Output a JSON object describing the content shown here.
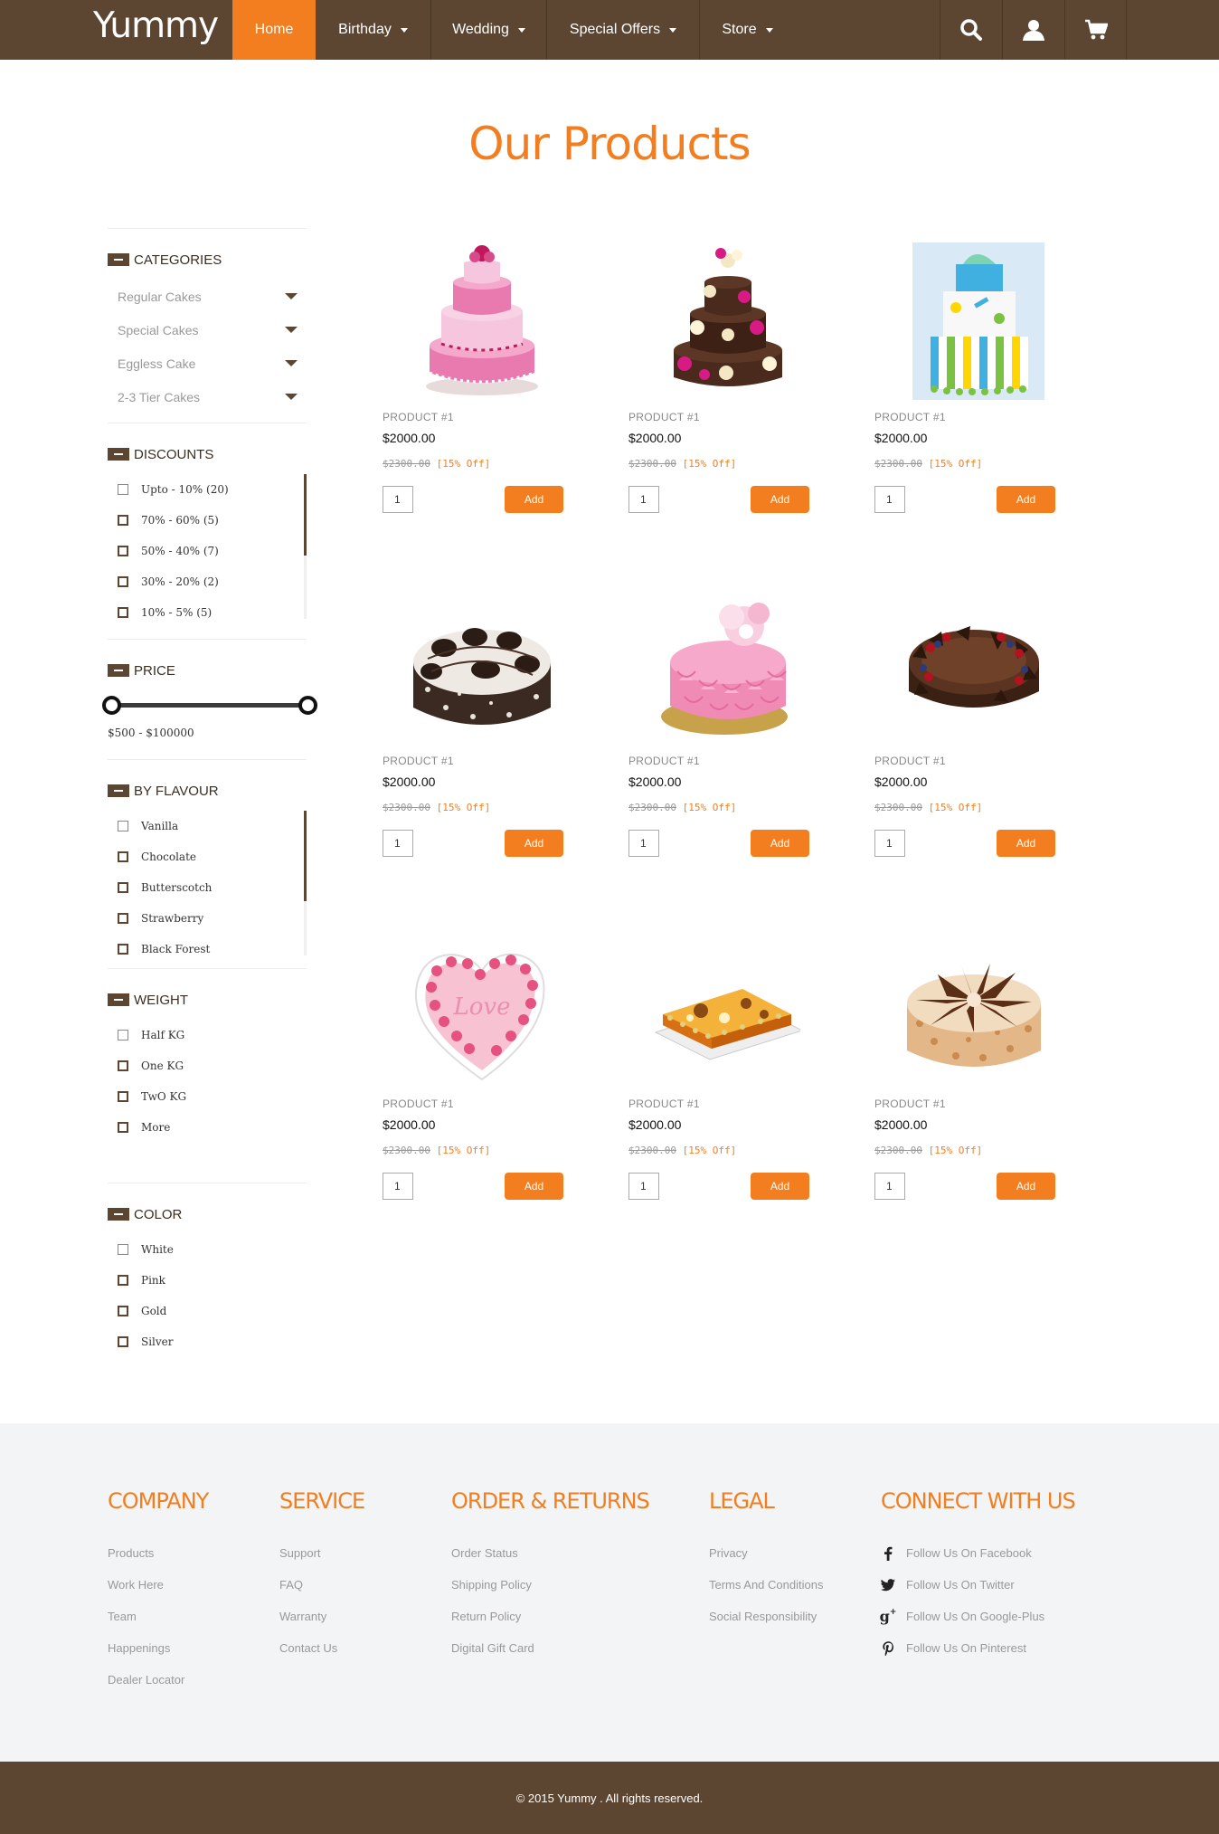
{
  "brand": {
    "logo": "Yummy",
    "accent": "#f27e1f",
    "dark": "#5c4631"
  },
  "nav": {
    "items": [
      {
        "label": "Home",
        "active": true,
        "dropdown": false
      },
      {
        "label": "Birthday",
        "dropdown": true
      },
      {
        "label": "Wedding",
        "dropdown": true
      },
      {
        "label": "Special Offers",
        "dropdown": true
      },
      {
        "label": "Store",
        "dropdown": true
      }
    ],
    "icons": [
      "search-icon",
      "user-icon",
      "cart-icon"
    ]
  },
  "page": {
    "title": "Our Products"
  },
  "filters": {
    "categories": {
      "title": "CATEGORIES",
      "items": [
        "Regular Cakes",
        "Special Cakes",
        "Eggless Cake",
        "2-3 Tier Cakes"
      ]
    },
    "discounts": {
      "title": "DISCOUNTS",
      "items": [
        "Upto - 10% (20)",
        "70% - 60% (5)",
        "50% - 40% (7)",
        "30% - 20% (2)",
        "10% - 5% (5)"
      ]
    },
    "price": {
      "title": "PRICE",
      "range": "$500 - $100000"
    },
    "flavour": {
      "title": "BY FLAVOUR",
      "items": [
        "Vanilla",
        "Chocolate",
        "Butterscotch",
        "Strawberry",
        "Black Forest"
      ]
    },
    "weight": {
      "title": "WEIGHT",
      "items": [
        "Half KG",
        "One KG",
        "TwO KG",
        "More"
      ]
    },
    "color": {
      "title": "COLOR",
      "items": [
        "White",
        "Pink",
        "Gold",
        "Silver"
      ]
    }
  },
  "products": [
    {
      "name": "PRODUCT #1",
      "price": "$2000.00",
      "old_price": "$2300.00",
      "discount": "[15% Off]",
      "qty": "1",
      "add_label": "Add",
      "image": "pink-tiered-cake"
    },
    {
      "name": "PRODUCT #1",
      "price": "$2000.00",
      "old_price": "$2300.00",
      "discount": "[15% Off]",
      "qty": "1",
      "add_label": "Add",
      "image": "chocolate-rose-tiered-cake"
    },
    {
      "name": "PRODUCT #1",
      "price": "$2000.00",
      "old_price": "$2300.00",
      "discount": "[15% Off]",
      "qty": "1",
      "add_label": "Add",
      "image": "striped-tiered-cake"
    },
    {
      "name": "PRODUCT #1",
      "price": "$2000.00",
      "old_price": "$2300.00",
      "discount": "[15% Off]",
      "qty": "1",
      "add_label": "Add",
      "image": "cookies-cream-cake"
    },
    {
      "name": "PRODUCT #1",
      "price": "$2000.00",
      "old_price": "$2300.00",
      "discount": "[15% Off]",
      "qty": "1",
      "add_label": "Add",
      "image": "pink-petal-cake"
    },
    {
      "name": "PRODUCT #1",
      "price": "$2000.00",
      "old_price": "$2300.00",
      "discount": "[15% Off]",
      "qty": "1",
      "add_label": "Add",
      "image": "chocolate-berry-cake"
    },
    {
      "name": "PRODUCT #1",
      "price": "$2000.00",
      "old_price": "$2300.00",
      "discount": "[15% Off]",
      "qty": "1",
      "add_label": "Add",
      "image": "heart-love-cake"
    },
    {
      "name": "PRODUCT #1",
      "price": "$2000.00",
      "old_price": "$2300.00",
      "discount": "[15% Off]",
      "qty": "1",
      "add_label": "Add",
      "image": "sheet-cake"
    },
    {
      "name": "PRODUCT #1",
      "price": "$2000.00",
      "old_price": "$2300.00",
      "discount": "[15% Off]",
      "qty": "1",
      "add_label": "Add",
      "image": "chocolate-curl-cake"
    }
  ],
  "footer": {
    "columns": [
      {
        "title": "COMPANY",
        "links": [
          "Products",
          "Work Here",
          "Team",
          "Happenings",
          "Dealer Locator"
        ]
      },
      {
        "title": "SERVICE",
        "links": [
          "Support",
          "FAQ",
          "Warranty",
          "Contact Us"
        ]
      },
      {
        "title": "ORDER & RETURNS",
        "links": [
          "Order Status",
          "Shipping Policy",
          "Return Policy",
          "Digital Gift Card"
        ]
      },
      {
        "title": "LEGAL",
        "links": [
          "Privacy",
          "Terms And Conditions",
          "Social Responsibility"
        ]
      },
      {
        "title": "CONNECT WITH US",
        "links": [
          "Follow Us On Facebook",
          "Follow Us On Twitter",
          "Follow Us On Google-Plus",
          "Follow Us On Pinterest"
        ]
      }
    ],
    "copyright": "© 2015 Yummy . All rights reserved."
  }
}
